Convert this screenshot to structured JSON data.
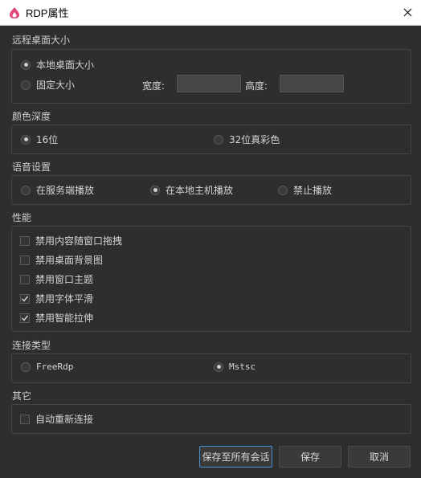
{
  "window": {
    "title": "RDP属性"
  },
  "desktop_size": {
    "section_label": "远程桌面大小",
    "local_option": "本地桌面大小",
    "fixed_option": "固定大小",
    "width_label": "宽度:",
    "height_label": "高度:",
    "width_value": "",
    "height_value": "",
    "selected": "local"
  },
  "color_depth": {
    "section_label": "颜色深度",
    "opt_16": "16位",
    "opt_32": "32位真彩色",
    "selected": "16"
  },
  "audio": {
    "section_label": "语音设置",
    "opt_server": "在服务端播放",
    "opt_local": "在本地主机播放",
    "opt_disable": "禁止播放",
    "selected": "local"
  },
  "performance": {
    "section_label": "性能",
    "items": [
      {
        "label": "禁用内容随窗口拖拽",
        "checked": false
      },
      {
        "label": "禁用桌面背景图",
        "checked": false
      },
      {
        "label": "禁用窗口主题",
        "checked": false
      },
      {
        "label": "禁用字体平滑",
        "checked": true
      },
      {
        "label": "禁用智能拉伸",
        "checked": true
      }
    ]
  },
  "connection_type": {
    "section_label": "连接类型",
    "opt_freerdp": "FreeRdp",
    "opt_mstsc": "Mstsc",
    "selected": "mstsc"
  },
  "other": {
    "section_label": "其它",
    "auto_reconnect": {
      "label": "自动重新连接",
      "checked": false
    }
  },
  "buttons": {
    "save_all": "保存至所有会话",
    "save": "保存",
    "cancel": "取消"
  },
  "colors": {
    "background": "#2e2e2e",
    "titlebar": "#ffffff",
    "accent_border": "#4a8fd0",
    "app_icon": "#e0457b"
  }
}
